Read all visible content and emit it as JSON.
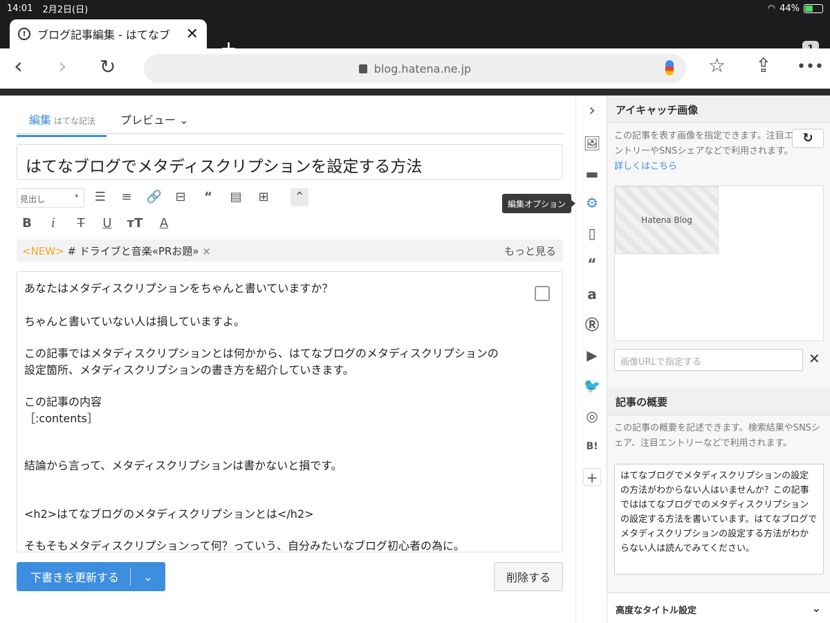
{
  "status_bar": {
    "time": "14:01",
    "date": "2月2日(日)",
    "battery": "44%",
    "battery_level": 0.44
  },
  "browser": {
    "tab_title": "ブログ記事編集 - はてなブ",
    "tab_count": "1",
    "url": "blog.hatena.ne.jp"
  },
  "editor": {
    "tab_edit": "編集",
    "tab_edit_sub": "はてな記法",
    "tab_preview": "プレビュー",
    "title": "はてなブログでメタディスクリプションを設定する方法",
    "heading_select": "見出し",
    "tags": {
      "new_label": "<NEW>",
      "tag": "# ドライブと音楽«PRお題»",
      "more": "もっと見る"
    },
    "body_lines": [
      "あなたはメタディスクリプションをちゃんと書いていますか？",
      "ちゃんと書いていない人は損していますよ。",
      "この記事ではメタディスクリプションとは何かから、はてなブログのメタディスクリプションの",
      "設定箇所、メタディスクリプションの書き方を紹介していきます。",
      "この記事の内容",
      "［:contents］",
      "結論から言って、メタディスクリプションは書かないと損です。",
      "<h2>はてなブログのメタディスクリプションとは</h2>",
      "そもそもメタディスクリプションって何？っていう、自分みたいなブログ初心者の為に。"
    ],
    "save_button": "下書きを更新する",
    "delete_button": "削除する",
    "tooltip": "編集オプション"
  },
  "side_panel": {
    "eyecatch_heading": "アイキャッチ画像",
    "eyecatch_desc": "この記事を表す画像を指定できます。注目エントリーやSNSシェアなどで利用されます。",
    "eyecatch_link": "詳しくはこちら",
    "thumb_label": "Hatena Blog",
    "url_placeholder": "画像URLで指定する",
    "summary_heading": "記事の概要",
    "summary_desc": "この記事の概要を記述できます。検索結果やSNSシェア、注目エントリーなどで利用されます。",
    "summary_text": "はてなブログでメタディスクリプションの設定の方法がわからない人はいませんか？この記事でははてなブログでのメタディスクリプションの設定する方法を書いています。はてなブログでメタディスクリプションの設定する方法がわからない人は読んでみてください。",
    "advanced_title": "高度なタイトル設定"
  },
  "colors": {
    "accent": "#3e8edf",
    "new_tag": "#f5a623"
  }
}
